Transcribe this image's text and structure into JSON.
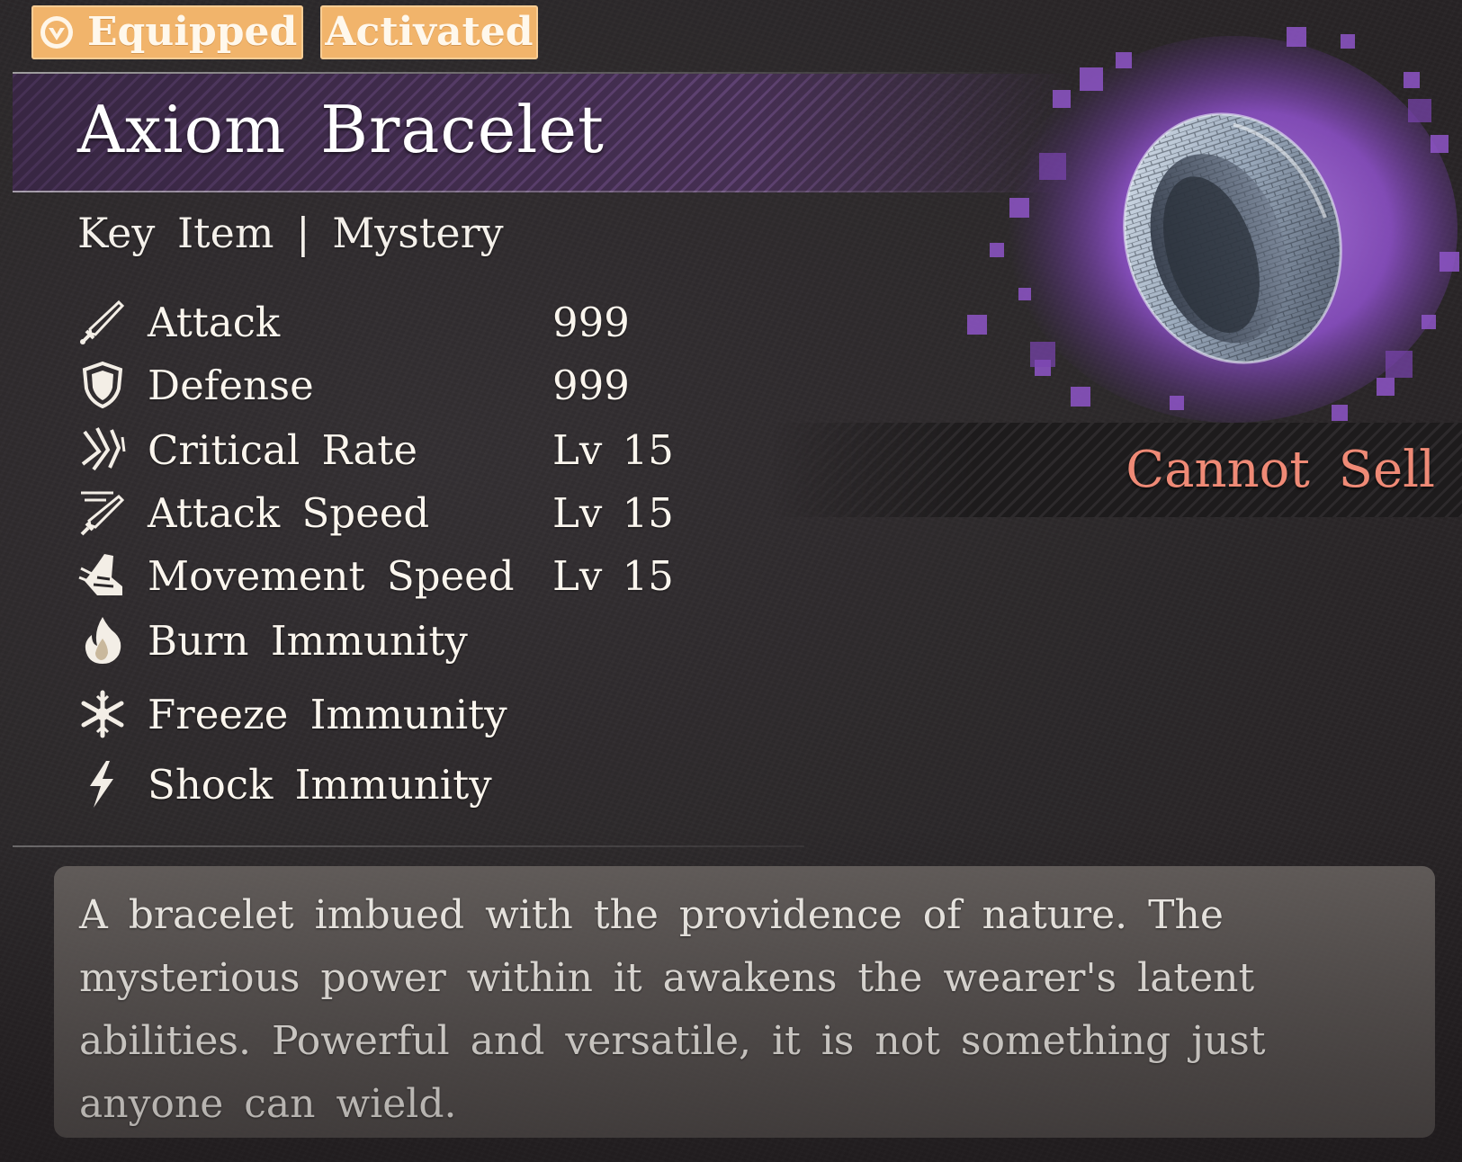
{
  "status_badges": {
    "equipped": {
      "label": "Equipped",
      "icon": "equipped-icon"
    },
    "activated": {
      "label": "Activated"
    }
  },
  "item": {
    "name": "Axiom Bracelet",
    "category": "Key Item | Mystery",
    "sell_status": "Cannot Sell",
    "image": "bracelet-item-image",
    "rarity_color": "#8a4fc4"
  },
  "stats": [
    {
      "icon": "sword-icon",
      "label": "Attack",
      "value": "999"
    },
    {
      "icon": "shield-icon",
      "label": "Defense",
      "value": "999"
    },
    {
      "icon": "critical-claw-icon",
      "label": "Critical Rate",
      "value": "Lv 15"
    },
    {
      "icon": "attack-speed-icon",
      "label": "Attack Speed",
      "value": "Lv 15"
    },
    {
      "icon": "boot-icon",
      "label": "Movement Speed",
      "value": "Lv 15"
    },
    {
      "icon": "flame-icon",
      "label": "Burn Immunity",
      "value": ""
    },
    {
      "icon": "snowflake-icon",
      "label": "Freeze Immunity",
      "value": ""
    },
    {
      "icon": "lightning-icon",
      "label": "Shock Immunity",
      "value": ""
    }
  ],
  "description": "A bracelet imbued with the providence of nature. The mysterious power within it awakens the wearer's latent abilities. Powerful and versatile, it is not something just anyone can wield.",
  "colors": {
    "badge": "#f1b46b",
    "title_band": "#5a3c6c",
    "cannot_sell": "#ef8a76",
    "text": "#fbf6ee",
    "background": "#2b2729"
  }
}
